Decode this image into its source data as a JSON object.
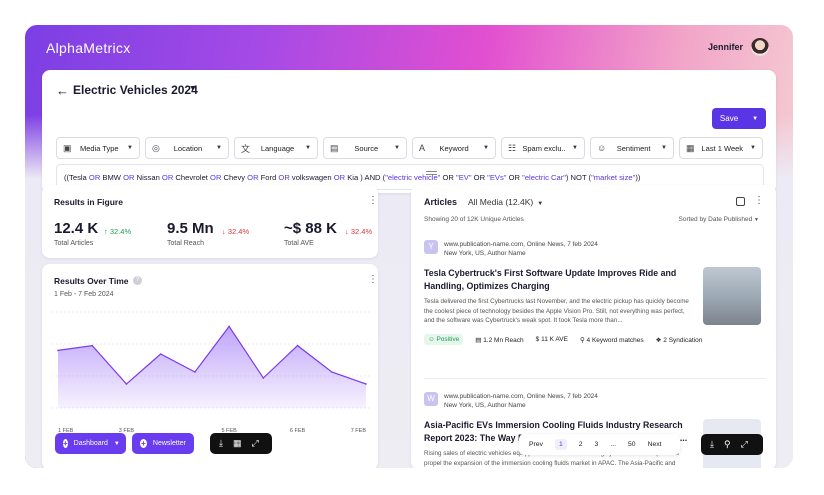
{
  "brand": {
    "logo": "AlphaMetricx",
    "user_name": "Jennifer"
  },
  "header": {
    "title": "Electric Vehicles 2024",
    "save_label": "Save"
  },
  "filters": [
    {
      "label": "Media Type",
      "icon": "media-icon"
    },
    {
      "label": "Location",
      "icon": "globe-icon"
    },
    {
      "label": "Language",
      "icon": "translate-icon"
    },
    {
      "label": "Source",
      "icon": "source-icon"
    },
    {
      "label": "Keyword",
      "icon": "keyword-icon"
    },
    {
      "label": "Spam exclu..",
      "icon": "spam-icon"
    },
    {
      "label": "Sentiment",
      "icon": "smile-icon"
    },
    {
      "label": "Last 1 Week",
      "icon": "calendar-icon"
    }
  ],
  "query": {
    "p1": "((Tesla ",
    "or": "OR",
    "p2": " BMW ",
    "p3": " Nissan ",
    "p4": " Chevrolet ",
    "p5": " Chevy ",
    "p6": " Ford ",
    "p7": " volkswagen ",
    "p8": " Kia ) AND (",
    "s1": "\"electric vehicle\"",
    "s2": "\"EV\"",
    "s3": "\"EVs\"",
    "s4": "\"electric Car\"",
    "s5": "\"market size\"",
    "c1": " OR ",
    "c2": ") NOT (",
    "c3": "))"
  },
  "results_in_figure": {
    "title": "Results in Figure",
    "metrics": [
      {
        "value": "12.4 K",
        "label": "Total Articles",
        "delta": "32.4%",
        "direction": "up"
      },
      {
        "value": "9.5 Mn",
        "label": "Total Reach",
        "delta": "32.4%",
        "direction": "down"
      },
      {
        "value": "~$ 88 K",
        "label": "Total AVE",
        "delta": "32.4%",
        "direction": "down"
      }
    ]
  },
  "results_over_time": {
    "title": "Results Over Time",
    "range": "1 Feb - 7 Feb 2024"
  },
  "chart_data": {
    "type": "area",
    "x": [
      "1 FEB",
      "",
      "3 FEB",
      "",
      "",
      "5 FEB",
      "",
      "6 FEB",
      "",
      "7 FEB"
    ],
    "values": [
      48,
      52,
      20,
      45,
      30,
      68,
      25,
      52,
      30,
      20
    ],
    "series_color": "#8b5cf6",
    "xlabel": "",
    "ylabel": ""
  },
  "bottom_actions": {
    "dashboard": "Dashboard",
    "newsletter": "Newsletter"
  },
  "articles": {
    "title": "Articles",
    "media_filter": "All Media (12.4K)",
    "showing": "Showing 20 of 12K Unique Articles",
    "sort": "Sorted by Date Published",
    "items": [
      {
        "avatar": "Y",
        "source": "www.publication-name.com, Online News, 7 feb 2024",
        "meta": "New York, US,  Author Name",
        "headline": "Tesla Cybertruck's First Software Update Improves Ride and Handling, Optimizes Charging",
        "excerpt": "Tesla delivered the first Cybertrucks last November, and the electric pickup has quickly become the coolest piece of technology besides the Apple Vision Pro. Still, not everything was perfect, and the software was Cybertruck's weak spot. It took Tesla more than...",
        "sentiment": "Positive",
        "reach": "1.2 Mn Reach",
        "ave": "11 K AVE",
        "keywords": "4 Keyword matches",
        "syndication": "2 Syndication"
      },
      {
        "avatar": "W",
        "source": "www.publication-name.com, Online News, 7 feb 2024",
        "meta": "New York, US,  Author Name",
        "headline": "Asia-Pacific EVs Immersion Cooling Fluids Industry Research Report 2023: The Way Forward for Electric Vehicle Battery Th...",
        "excerpt": "Rising sales of electric vehicles equipped with immersion cooling systems are anticipated to propel the expansion of the immersion cooling fluids market in APAC. The Asia-Pacific and Japan region is a hotspot for..."
      }
    ]
  },
  "pagination": {
    "prev": "Prev",
    "pages": [
      "1",
      "2",
      "3",
      "...",
      "50"
    ],
    "next": "Next"
  }
}
